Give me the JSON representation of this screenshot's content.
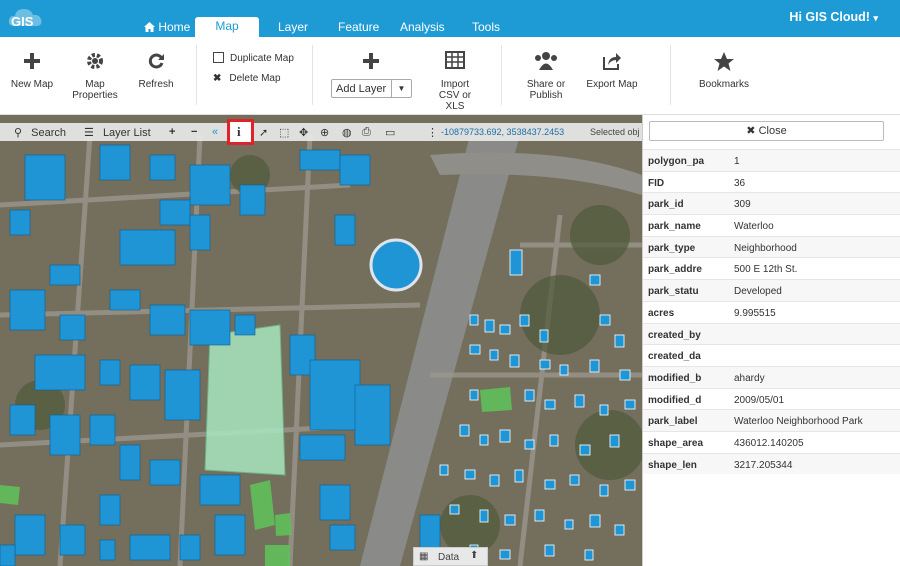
{
  "app": {
    "logo_text": "GIS",
    "user_label": "Hi GIS Cloud!"
  },
  "nav": {
    "tabs": [
      "Home",
      "Map",
      "Layer",
      "Feature",
      "Analysis",
      "Tools"
    ],
    "active": "Map"
  },
  "ribbon": {
    "new_map": "New Map",
    "map_properties": "Map Properties",
    "refresh": "Refresh",
    "duplicate_map": "Duplicate Map",
    "delete_map": "Delete Map",
    "add_layer": "Add Layer",
    "import_csv": "Import CSV or XLS",
    "share_publish": "Share or Publish",
    "export_map": "Export Map",
    "bookmarks": "Bookmarks"
  },
  "map_toolbar": {
    "search": "Search",
    "layer_list": "Layer List",
    "coordinates": "-10879733.692, 3538437.2453",
    "selected": "Selected obj"
  },
  "data_tab": "Data",
  "panel": {
    "close_label": "Close",
    "attributes": [
      {
        "key": "polygon_pa",
        "value": "1"
      },
      {
        "key": "FID",
        "value": "36"
      },
      {
        "key": "park_id",
        "value": "309"
      },
      {
        "key": "park_name",
        "value": "Waterloo"
      },
      {
        "key": "park_type",
        "value": "Neighborhood"
      },
      {
        "key": "park_addre",
        "value": "500 E 12th St."
      },
      {
        "key": "park_statu",
        "value": "Developed"
      },
      {
        "key": "acres",
        "value": "9.995515"
      },
      {
        "key": "created_by",
        "value": ""
      },
      {
        "key": "created_da",
        "value": ""
      },
      {
        "key": "modified_b",
        "value": "ahardy"
      },
      {
        "key": "modified_d",
        "value": "2009/05/01"
      },
      {
        "key": "park_label",
        "value": "Waterloo Neighborhood Park"
      },
      {
        "key": "shape_area",
        "value": "436012.140205"
      },
      {
        "key": "shape_len",
        "value": "3217.205344"
      }
    ]
  },
  "colors": {
    "brand": "#1e9bd4",
    "building": "#1f95d6",
    "park": "#9ee0b4",
    "highlight": "#e0222a"
  }
}
